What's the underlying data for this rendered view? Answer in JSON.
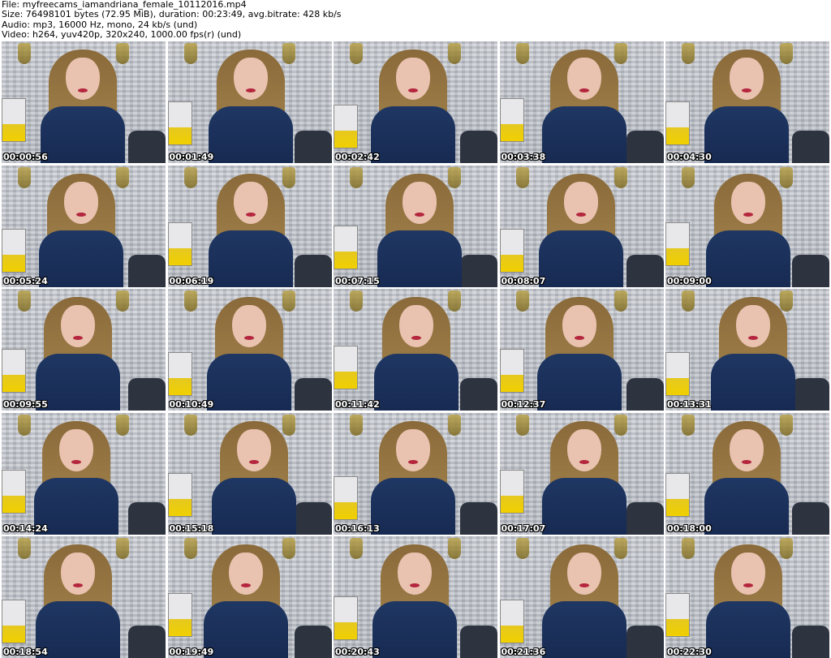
{
  "header": {
    "file": "File: myfreecams_iamandriana_female_10112016.mp4",
    "size": "Size: 76498101 bytes (72.95 MiB), duration: 00:23:49, avg.bitrate: 428 kb/s",
    "audio": "Audio: mp3, 16000 Hz, mono, 24 kb/s (und)",
    "video": "Video: h264, yuv420p, 320x240, 1000.00 fps(r) (und)"
  },
  "thumbnails": [
    {
      "timestamp": "00:00:56"
    },
    {
      "timestamp": "00:01:49"
    },
    {
      "timestamp": "00:02:42"
    },
    {
      "timestamp": "00:03:38"
    },
    {
      "timestamp": "00:04:30"
    },
    {
      "timestamp": "00:05:24"
    },
    {
      "timestamp": "00:06:19"
    },
    {
      "timestamp": "00:07:15"
    },
    {
      "timestamp": "00:08:07"
    },
    {
      "timestamp": "00:09:00"
    },
    {
      "timestamp": "00:09:55"
    },
    {
      "timestamp": "00:10:49"
    },
    {
      "timestamp": "00:11:42"
    },
    {
      "timestamp": "00:12:37"
    },
    {
      "timestamp": "00:13:31"
    },
    {
      "timestamp": "00:14:24"
    },
    {
      "timestamp": "00:15:18"
    },
    {
      "timestamp": "00:16:13"
    },
    {
      "timestamp": "00:17:07"
    },
    {
      "timestamp": "00:18:00"
    },
    {
      "timestamp": "00:18:54"
    },
    {
      "timestamp": "00:19:49"
    },
    {
      "timestamp": "00:20:43"
    },
    {
      "timestamp": "00:21:36"
    },
    {
      "timestamp": "00:22:30"
    }
  ]
}
